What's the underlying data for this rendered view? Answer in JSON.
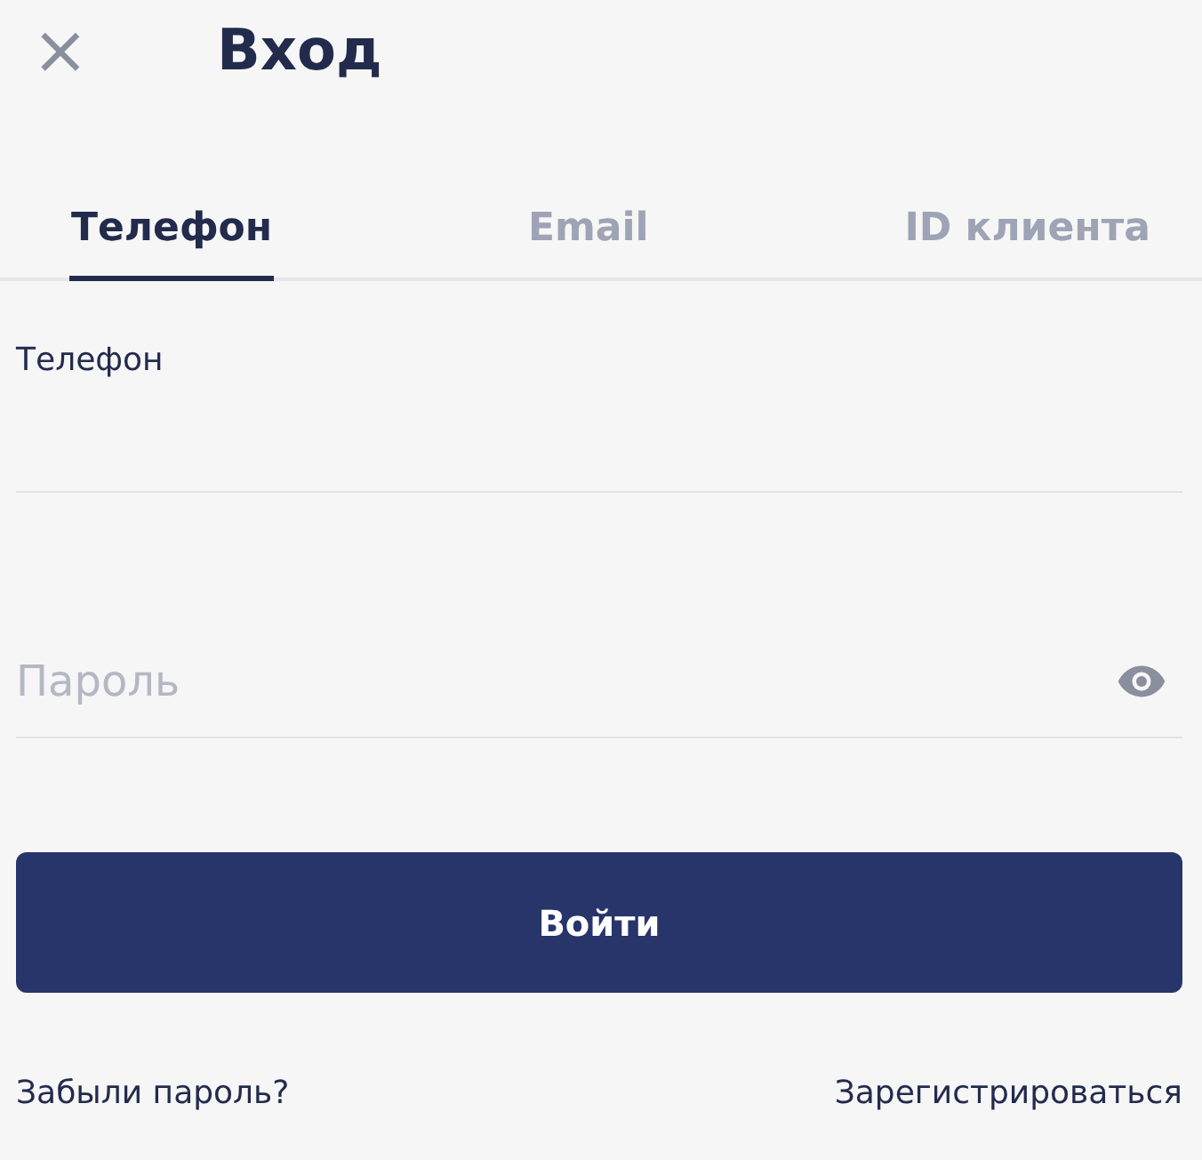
{
  "header": {
    "close": "×",
    "title": "Вход"
  },
  "tabs": [
    {
      "label": "Телефон",
      "selected": true
    },
    {
      "label": "Email",
      "selected": false
    },
    {
      "label": "ID клиента",
      "selected": false
    }
  ],
  "phone_field": {
    "label": "Телефон"
  },
  "password_field": {
    "placeholder": "Пароль"
  },
  "submit_button": "Войти",
  "links": {
    "forgot": "Забыли пароль?",
    "register": "Зарегистрироваться"
  }
}
